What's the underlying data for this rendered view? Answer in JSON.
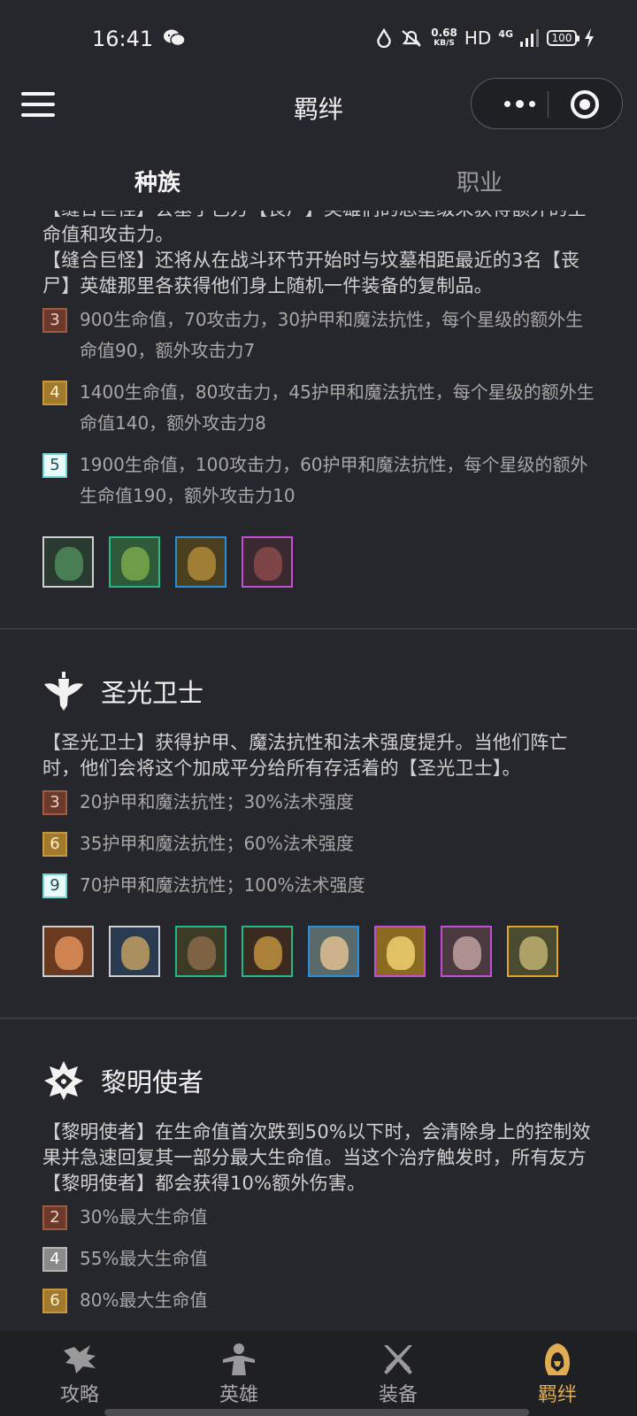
{
  "status": {
    "time": "16:41",
    "net_speed": "0.68",
    "net_unit": "KB/S",
    "hd": "HD",
    "signal": "4G",
    "battery": "100"
  },
  "nav": {
    "title": "羁绊"
  },
  "tabs": [
    {
      "label": "种族",
      "active": true
    },
    {
      "label": "职业",
      "active": false
    }
  ],
  "sections": [
    {
      "title": "",
      "desc_lines": [
        "【缝合巨怪】会基于己方【丧尸】英雄们的总星级来获得额外的生命值和攻击力。",
        "【缝合巨怪】还将从在战斗环节开始时与坟墓相距最近的3名【丧尸】英雄那里各获得他们身上随机一件装备的复制品。"
      ],
      "tiers": [
        {
          "count": "3",
          "text": "900生命值，70攻击力，30护甲和魔法抗性，每个星级的额外生命值90，额外攻击力7"
        },
        {
          "count": "4",
          "text": "1400生命值，80攻击力，45护甲和魔法抗性，每个星级的额外生命值140，额外攻击力8"
        },
        {
          "count": "5",
          "text": "1900生命值，100攻击力，60护甲和魔法抗性，每个星级的额外生命值190，额外攻击力10"
        }
      ],
      "heroes": [
        "white",
        "green",
        "blue",
        "purple"
      ]
    },
    {
      "title": "圣光卫士",
      "icon": "sentinel-icon",
      "desc_lines": [
        "【圣光卫士】获得护甲、魔法抗性和法术强度提升。当他们阵亡时，他们会将这个加成平分给所有存活着的【圣光卫士】。"
      ],
      "tiers": [
        {
          "count": "3",
          "text": "20护甲和魔法抗性；30%法术强度"
        },
        {
          "count": "6",
          "text": "35护甲和魔法抗性；60%法术强度"
        },
        {
          "count": "9",
          "text": "70护甲和魔法抗性；100%法术强度"
        }
      ],
      "heroes": [
        "white",
        "white",
        "green",
        "green",
        "blue",
        "purple",
        "purple",
        "gold"
      ]
    },
    {
      "title": "黎明使者",
      "icon": "dawnbringer-icon",
      "desc_lines": [
        "【黎明使者】在生命值首次跌到50%以下时，会清除身上的控制效果并急速回复其一部分最大生命值。当这个治疗触发时，所有友方【黎明使者】都会获得10%额外伤害。"
      ],
      "tiers": [
        {
          "count": "2",
          "text": "30%最大生命值"
        },
        {
          "count": "4",
          "text": "55%最大生命值"
        },
        {
          "count": "6",
          "text": "80%最大生命值"
        }
      ]
    }
  ],
  "tabbar": [
    {
      "label": "攻略",
      "icon": "dragon-icon",
      "active": false
    },
    {
      "label": "英雄",
      "icon": "hero-icon",
      "active": false
    },
    {
      "label": "装备",
      "icon": "swords-icon",
      "active": false
    },
    {
      "label": "羁绊",
      "icon": "hood-icon",
      "active": true
    }
  ],
  "colors": {
    "background": "#26272c",
    "active_tab": "#e0ad52",
    "tier_bronze": "#6b3a2c",
    "tier_gold": "#a17a2d",
    "tier_platinum": "#e8faf9",
    "tier_silver": "#8a8a8a"
  }
}
